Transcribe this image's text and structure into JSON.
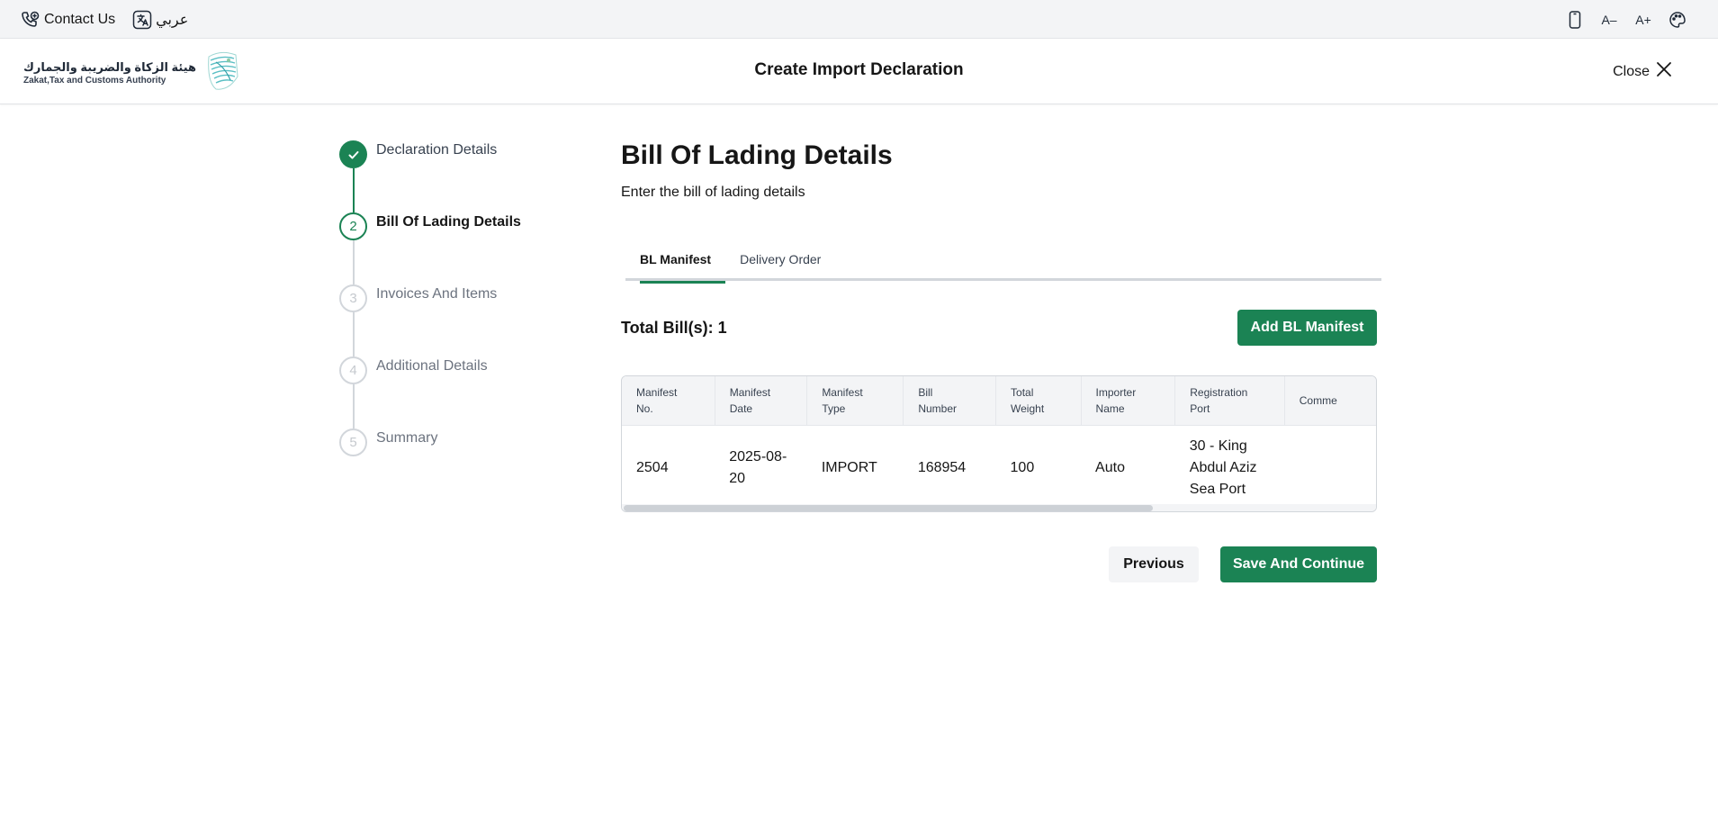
{
  "utility": {
    "contact_label": "Contact Us",
    "language_label": "عربي",
    "font_decrease": "A–",
    "font_increase": "A+"
  },
  "header": {
    "logo_arabic": "هيئة الزكاة والضريبة والجمارك",
    "logo_english": "Zakat,Tax and Customs Authority",
    "title": "Create Import Declaration",
    "close_label": "Close"
  },
  "stepper": {
    "steps": [
      {
        "number": "1",
        "label": "Declaration Details",
        "state": "done"
      },
      {
        "number": "2",
        "label": "Bill Of Lading Details",
        "state": "current"
      },
      {
        "number": "3",
        "label": "Invoices And Items",
        "state": "todo"
      },
      {
        "number": "4",
        "label": "Additional Details",
        "state": "todo"
      },
      {
        "number": "5",
        "label": "Summary",
        "state": "todo"
      }
    ]
  },
  "main": {
    "title": "Bill Of Lading Details",
    "subtitle": "Enter the bill of lading details",
    "tabs": [
      {
        "label": "BL Manifest",
        "active": true
      },
      {
        "label": "Delivery Order",
        "active": false
      }
    ],
    "total_label": "Total Bill(s): 1",
    "add_button": "Add BL Manifest",
    "table": {
      "headers": [
        [
          "Manifest",
          "No."
        ],
        [
          "Manifest",
          "Date"
        ],
        [
          "Manifest",
          "Type"
        ],
        [
          "Bill",
          "Number"
        ],
        [
          "Total",
          "Weight"
        ],
        [
          "Importer",
          "Name"
        ],
        [
          "Registration",
          "Port"
        ],
        [
          "Comme",
          ""
        ]
      ],
      "rows": [
        {
          "cells": [
            [
              "2504"
            ],
            [
              "2025-08-",
              "20"
            ],
            [
              "IMPORT"
            ],
            [
              "168954"
            ],
            [
              "100"
            ],
            [
              "Auto"
            ],
            [
              "30 - King",
              "Abdul Aziz",
              "Sea Port"
            ],
            [
              ""
            ]
          ]
        }
      ]
    },
    "previous_button": "Previous",
    "save_button": "Save And Continue"
  },
  "colors": {
    "primary": "#1b8354",
    "step_inactive": "#d2d6db",
    "header_bg": "#f3f4f6"
  }
}
